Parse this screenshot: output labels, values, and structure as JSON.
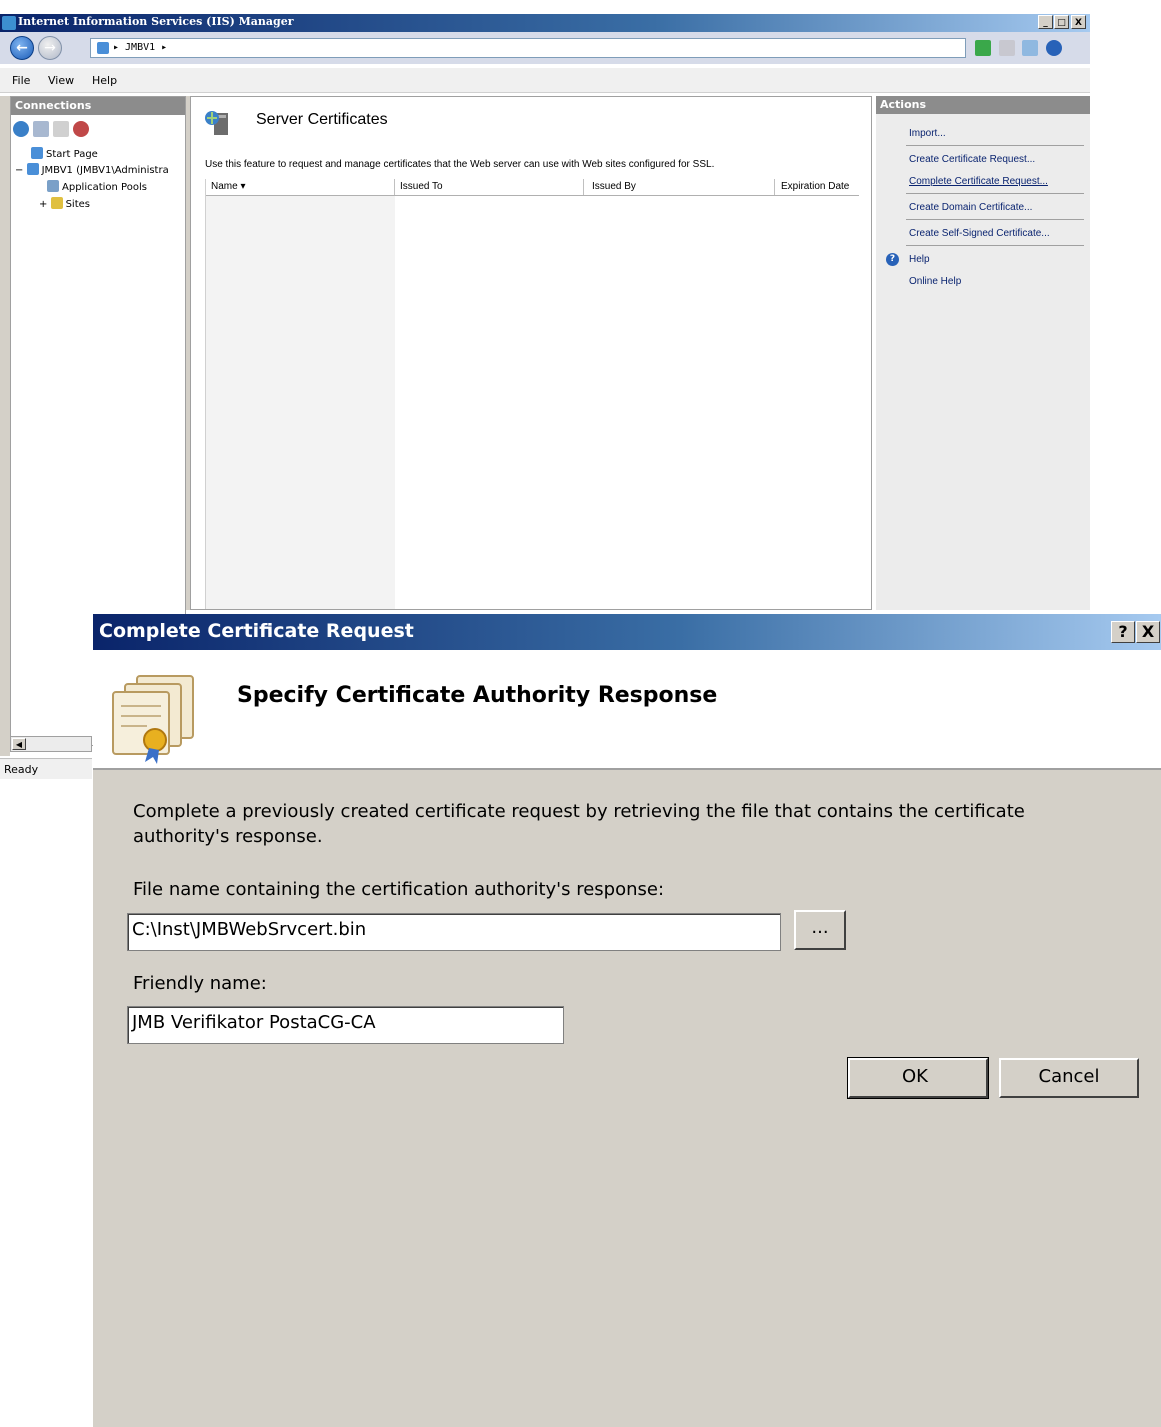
{
  "window": {
    "title": "Internet Information Services (IIS) Manager",
    "controls": [
      "_",
      "□",
      "X"
    ],
    "address": "▸ JMBV1 ▸"
  },
  "menu": [
    "File",
    "View",
    "Help"
  ],
  "connections": {
    "header": "Connections",
    "tree": [
      {
        "label": "Start Page"
      },
      {
        "label": "JMBV1 (JMBV1\\Administra",
        "expander": "−"
      },
      {
        "label": "Application Pools"
      },
      {
        "label": "Sites",
        "expander": "+"
      }
    ]
  },
  "feature": {
    "title": "Server Certificates",
    "description": "Use this feature to request and manage certificates that the Web server can use with Web sites configured for SSL.",
    "columns": [
      "Name ▾",
      "Issued To",
      "Issued By",
      "Expiration Date"
    ]
  },
  "actions": {
    "header": "Actions",
    "items": [
      "Import...",
      "Create Certificate Request...",
      "Complete Certificate Request...",
      "Create Domain Certificate...",
      "Create Self-Signed Certificate...",
      "Help",
      "Online Help"
    ]
  },
  "status": "Ready",
  "dialog": {
    "title": "Complete Certificate Request",
    "heading": "Specify Certificate Authority Response",
    "intro_line1": "Complete a previously created certificate request by retrieving the file that contains the certificate",
    "intro_line2": "authority's response.",
    "file_label": "File name containing the certification authority's response:",
    "file_value": "C:\\Inst\\JMBWebSrvcert.bin",
    "browse_label": "...",
    "friendly_label": "Friendly name:",
    "friendly_value": "JMB Verifikator PostaCG-CA",
    "ok_label": "OK",
    "cancel_label": "Cancel",
    "help_ctl": "?",
    "close_ctl": "X"
  },
  "colors": {
    "title_start": "#0a246a",
    "title_end": "#a6caf0",
    "link": "#0a2470",
    "dialog_bg": "#d4d0c8"
  }
}
